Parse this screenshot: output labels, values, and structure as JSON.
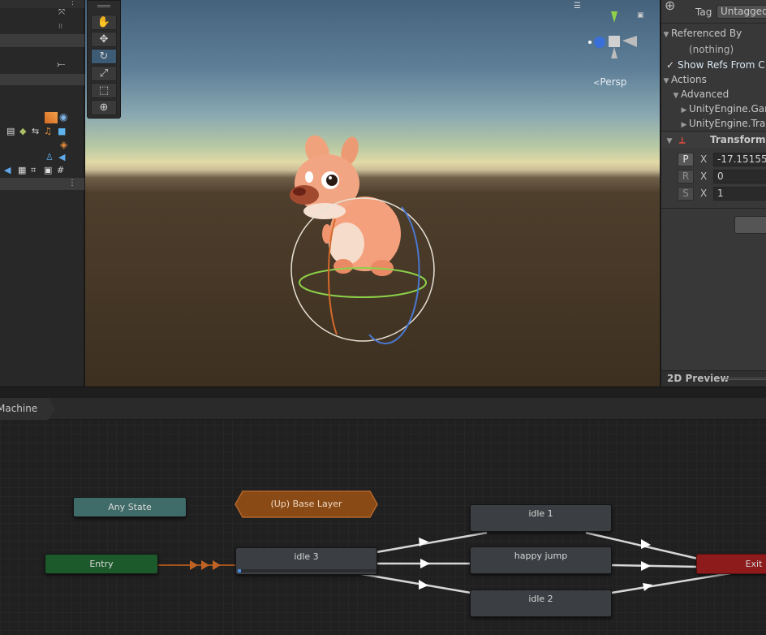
{
  "scene": {
    "persp_label": "Persp",
    "tools": [
      "hand-tool",
      "move-tool",
      "rotate-tool",
      "scale-tool",
      "rect-tool",
      "transform-tool"
    ],
    "active_tool": "rotate-tool"
  },
  "inspector": {
    "tag_label": "Tag",
    "tag_value": "Untagged",
    "referenced_by": "Referenced By",
    "nothing": "(nothing)",
    "show_refs": "Show Refs From C",
    "actions": "Actions",
    "advanced": "Advanced",
    "engine_item_1": "UnityEngine.Gam",
    "engine_item_2": "UnityEngine.Tran",
    "transform_title": "Transform",
    "rows": [
      {
        "btn": "P",
        "axis": "X",
        "value": "-17.15155"
      },
      {
        "btn": "R",
        "axis": "X",
        "value": "0"
      },
      {
        "btn": "S",
        "axis": "X",
        "value": "1"
      }
    ],
    "preview_label": "2D Preview"
  },
  "animator": {
    "breadcrumb": "Machine",
    "nodes": {
      "any_state": "Any State",
      "base_layer": "(Up) Base Layer",
      "entry": "Entry",
      "idle3": "idle 3",
      "idle1": "idle 1",
      "happy_jump": "happy jump",
      "idle2": "idle 2",
      "exit": "Exit"
    },
    "colors": {
      "any_state": "#3f6b68",
      "base_layer": "#8a4a16",
      "entry": "#1c5a2c",
      "exit": "#8e1b1b",
      "state": "#3b3e42",
      "transition": "#d7d7d7",
      "entry_transition": "#a4531b"
    }
  }
}
